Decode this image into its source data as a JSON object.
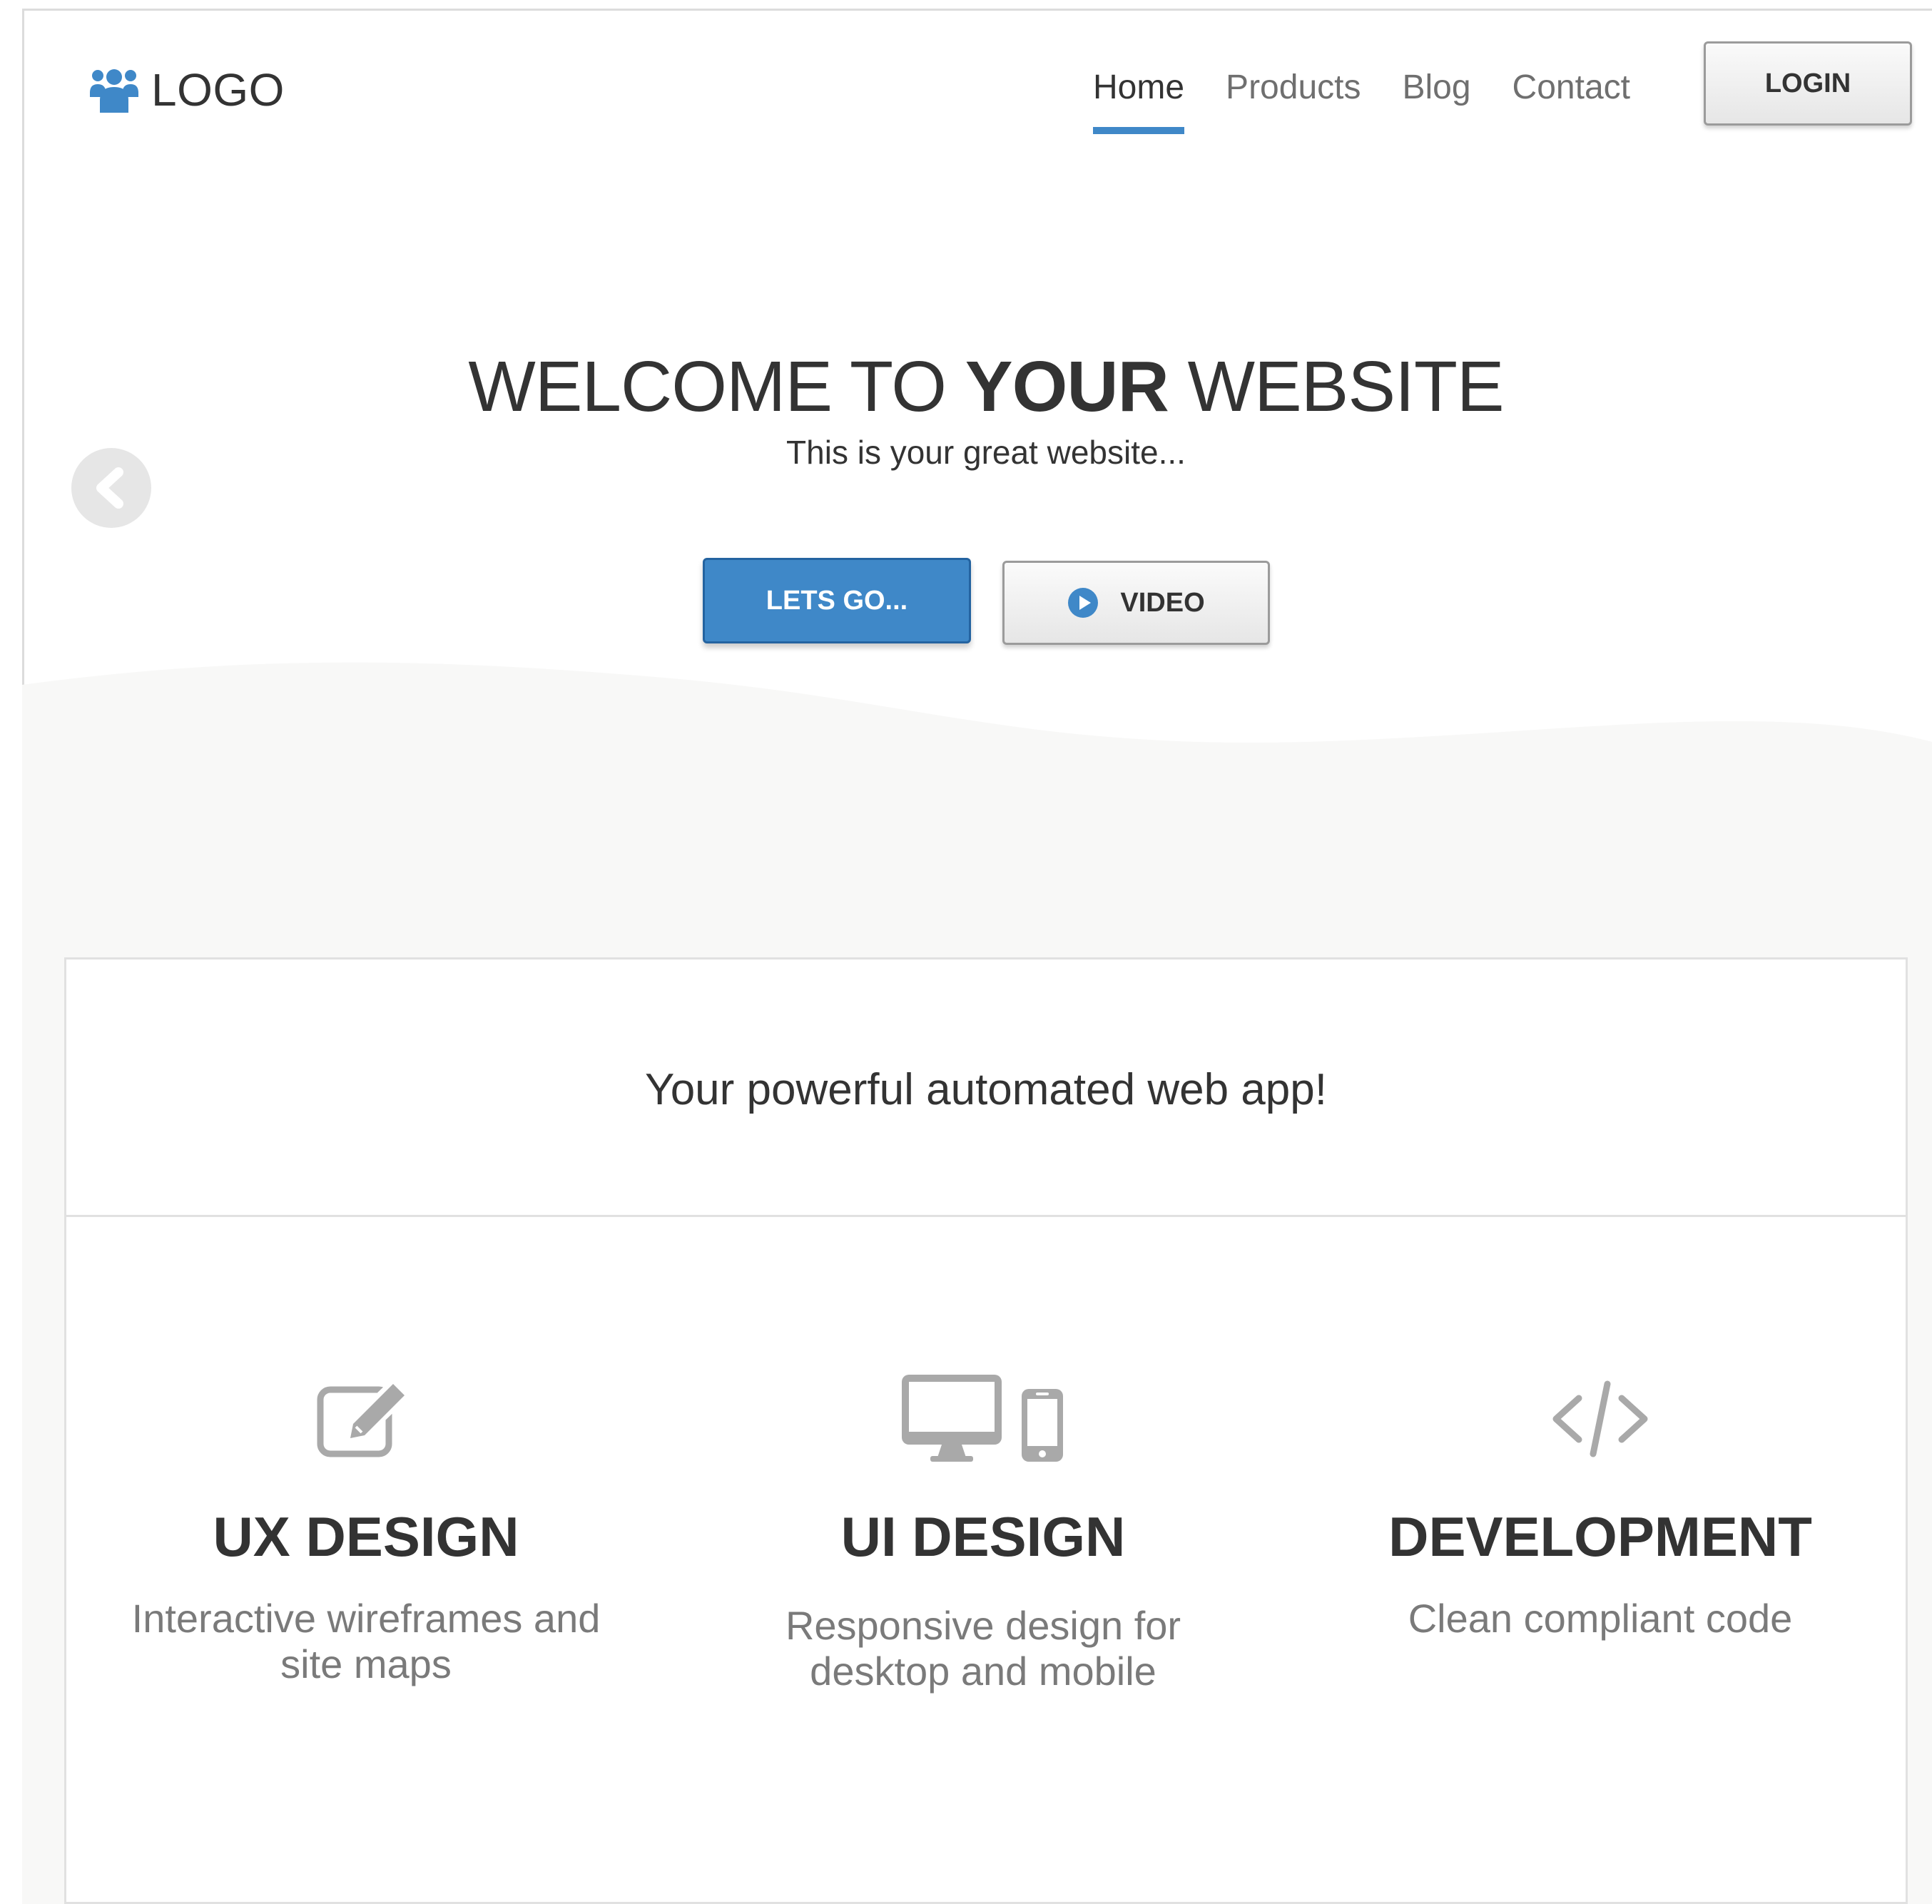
{
  "header": {
    "logo_text": "LOGO",
    "nav": [
      {
        "label": "Home",
        "active": true
      },
      {
        "label": "Products",
        "active": false
      },
      {
        "label": "Blog",
        "active": false
      },
      {
        "label": "Contact",
        "active": false
      }
    ],
    "login_label": "LOGIN"
  },
  "hero": {
    "title_part1": "WELCOME TO ",
    "title_bold": "YOUR",
    "title_part2": " WEBSITE",
    "subtitle": "This is your great website...",
    "primary_button": "LETS GO...",
    "secondary_button": "VIDEO"
  },
  "panel": {
    "tagline": "Your powerful automated web app!",
    "features": [
      {
        "icon": "edit-icon",
        "title": "UX DESIGN",
        "description": "Interactive wireframes and site maps"
      },
      {
        "icon": "desktop-mobile-icon",
        "title": "UI DESIGN",
        "description": "Responsive design for desktop and mobile"
      },
      {
        "icon": "code-icon",
        "title": "DEVELOPMENT",
        "description": "Clean compliant code"
      }
    ]
  },
  "colors": {
    "accent": "#3f88c8",
    "text": "#333333",
    "muted": "#7a7a7a",
    "icon_gray": "#a9a9a9",
    "background_gray": "#f8f8f7"
  }
}
